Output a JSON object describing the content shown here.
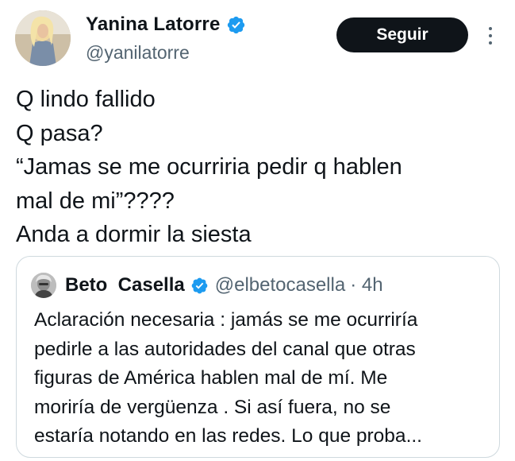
{
  "author": {
    "name": "Yanina Latorre",
    "handle": "@yanilatorre",
    "verified": true,
    "avatar_icon": "profile-photo"
  },
  "actions": {
    "follow_label": "Seguir",
    "more_icon": "more-vertical-icon"
  },
  "tweet": {
    "lines": [
      "Q lindo fallido",
      "Q pasa?",
      "“Jamas se me ocurriria pedir q hablen",
      "mal de mi”????",
      "Anda a dormir la siesta"
    ]
  },
  "quoted": {
    "name": "Beto  Casella",
    "handle": "@elbetocasella",
    "time": "· 4h",
    "verified": true,
    "lines": [
      "Aclaración necesaria : jamás se me ocurriría",
      "pedirle a las autoridades del canal que otras",
      "figuras de América hablen mal de mí. Me",
      "moriría de vergüenza . Si así fuera, no se",
      "estaría notando en las redes. Lo que proba..."
    ]
  },
  "colors": {
    "verified_blue": "#1d9bf0",
    "button_bg": "#0f1419",
    "secondary_text": "#536471",
    "border": "#cfd9de"
  }
}
